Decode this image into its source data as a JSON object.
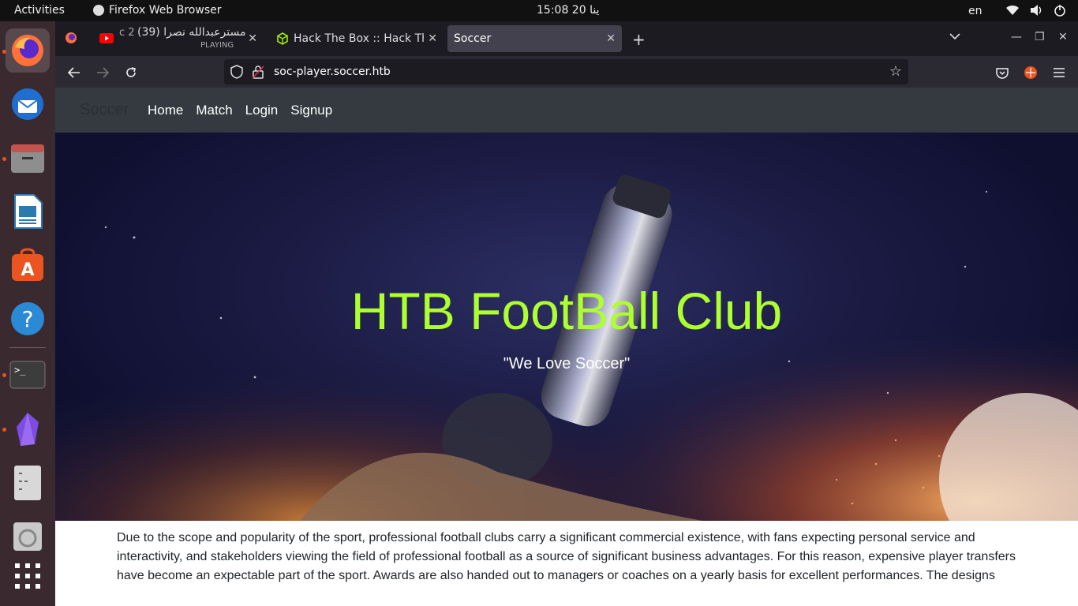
{
  "system": {
    "activities": "Activities",
    "app_name": "Firefox Web Browser",
    "clock": "15:08  20 ينا",
    "language": "en"
  },
  "browser": {
    "tabs": [
      {
        "title": "مسترعبدالله نصرا (39)",
        "prefix": "c 2",
        "sub": "PLAYING",
        "icon": "youtube-icon"
      },
      {
        "title": "Hack The Box :: Hack The",
        "icon": "hackthebox-icon"
      },
      {
        "title": "Soccer",
        "icon": ""
      }
    ],
    "url": "soc-player.soccer.htb"
  },
  "site": {
    "brand": "Soccer",
    "nav": [
      "Home",
      "Match",
      "Login",
      "Signup"
    ],
    "hero_title": "HTB FootBall Club",
    "hero_subtitle": "\"We Love Soccer\"",
    "body_text": "Due to the scope and popularity of the sport, professional football clubs carry a significant commercial existence, with fans expecting personal service and interactivity, and stakeholders viewing the field of professional football as a source of significant business advantages. For this reason, expensive player transfers have become an expectable part of the sport. Awards are also handed out to managers or coaches on a yearly basis for excellent performances. The designs"
  },
  "colors": {
    "hero_title": "#adff2f",
    "nav_bg": "#343a40",
    "dock_bg": "#3a2a2f"
  }
}
